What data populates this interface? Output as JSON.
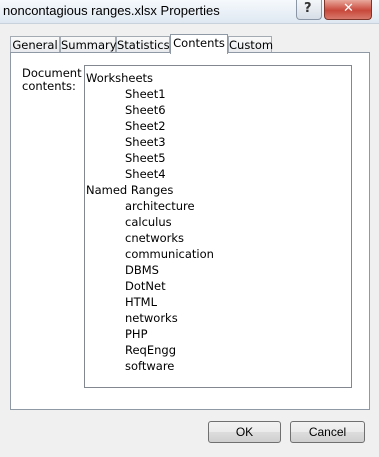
{
  "window": {
    "title": "noncontagious ranges.xlsx Properties",
    "help_glyph": "?",
    "close_glyph": "✕"
  },
  "tabs": [
    {
      "label": "General",
      "active": false
    },
    {
      "label": "Summary",
      "active": false
    },
    {
      "label": "Statistics",
      "active": false
    },
    {
      "label": "Contents",
      "active": true
    },
    {
      "label": "Custom",
      "active": false
    }
  ],
  "contents": {
    "label": "Document contents:",
    "groups": [
      {
        "name": "Worksheets",
        "items": [
          "Sheet1",
          "Sheet6",
          "Sheet2",
          "Sheet3",
          "Sheet5",
          "Sheet4"
        ]
      },
      {
        "name": "Named Ranges",
        "items": [
          "architecture",
          "calculus",
          "cnetworks",
          "communication",
          "DBMS",
          "DotNet",
          "HTML",
          "networks",
          "PHP",
          "ReqEngg",
          "software"
        ]
      }
    ]
  },
  "buttons": {
    "ok": "OK",
    "cancel": "Cancel"
  }
}
